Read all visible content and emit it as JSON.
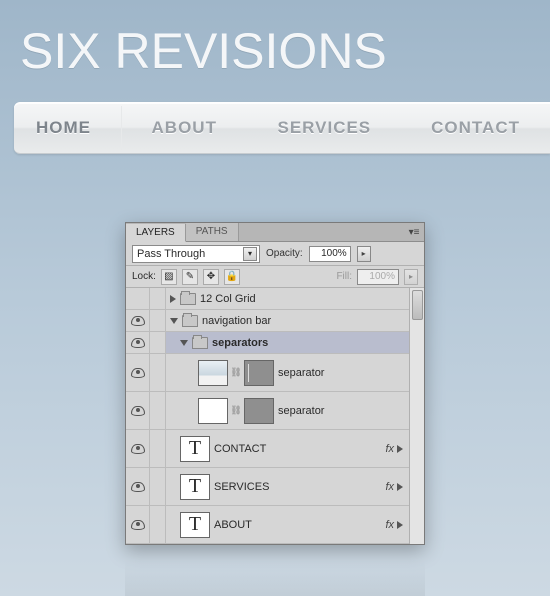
{
  "site": {
    "title": "SIX REVISIONS"
  },
  "nav": {
    "items": [
      {
        "label": "HOME",
        "active": true
      },
      {
        "label": "ABOUT"
      },
      {
        "label": "SERVICES"
      },
      {
        "label": "CONTACT"
      }
    ]
  },
  "panel": {
    "tabs": {
      "layers": "LAYERS",
      "paths": "PATHS"
    },
    "blend_mode": "Pass Through",
    "opacity_label": "Opacity:",
    "opacity_value": "100%",
    "lock_label": "Lock:",
    "fill_label": "Fill:",
    "fill_value": "100%",
    "layers": [
      {
        "type": "group",
        "name": "12 Col Grid",
        "visible": false,
        "expanded": false,
        "depth": 0
      },
      {
        "type": "group",
        "name": "navigation bar",
        "visible": true,
        "expanded": true,
        "depth": 0
      },
      {
        "type": "group",
        "name": "separators",
        "visible": true,
        "expanded": true,
        "depth": 1,
        "selected": true
      },
      {
        "type": "layer_mask",
        "name": "separator",
        "visible": true,
        "depth": 2
      },
      {
        "type": "layer_mask",
        "name": "separator",
        "visible": true,
        "depth": 2
      },
      {
        "type": "text",
        "name": "CONTACT",
        "visible": true,
        "depth": 1,
        "fx": true
      },
      {
        "type": "text",
        "name": "SERVICES",
        "visible": true,
        "depth": 1,
        "fx": true
      },
      {
        "type": "text",
        "name": "ABOUT",
        "visible": true,
        "depth": 1,
        "fx": true
      }
    ],
    "fx_label": "fx",
    "text_glyph": "T"
  }
}
